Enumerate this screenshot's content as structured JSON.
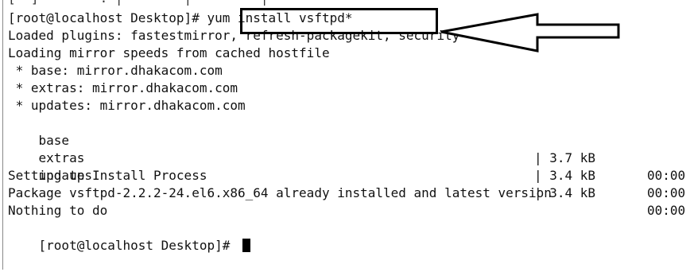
{
  "terminal": {
    "clipped_top": "[  ]        . |        |         |       ",
    "lines": [
      "[root@localhost Desktop]# yum install vsftpd*",
      "Loaded plugins: fastestmirror, refresh-packagekit, security",
      "Loading mirror speeds from cached hostfile",
      " * base: mirror.dhakacom.com",
      " * extras: mirror.dhakacom.com",
      " * updates: mirror.dhakacom.com"
    ],
    "repos": [
      {
        "name": "base",
        "size": "| 3.7 kB",
        "time": "00:00"
      },
      {
        "name": "extras",
        "size": "| 3.4 kB",
        "time": "00:00"
      },
      {
        "name": "updates",
        "size": "| 3.4 kB",
        "time": "00:00"
      }
    ],
    "tail": [
      "Setting up Install Process",
      "Package vsftpd-2.2.2-24.el6.x86_64 already installed and latest version",
      "Nothing to do"
    ],
    "prompt": "[root@localhost Desktop]# "
  },
  "annotation": {
    "box_color": "#000000",
    "arrow_color": "#000000",
    "highlighted_command": "yum install vsftpd*"
  }
}
